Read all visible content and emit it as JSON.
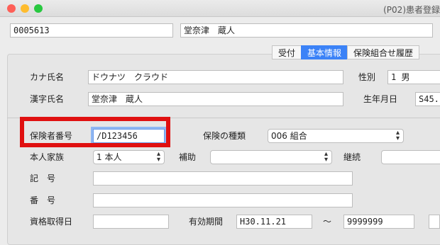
{
  "window": {
    "title": "(P02)患者登録"
  },
  "header": {
    "patient_id": "0005613",
    "patient_name": "堂奈津　蔵人"
  },
  "tabs": [
    {
      "label": "受付",
      "active": false
    },
    {
      "label": "基本情報",
      "active": true
    },
    {
      "label": "保険組合せ履歴",
      "active": false
    }
  ],
  "basic": {
    "kana_label": "カナ氏名",
    "kana_value": "ドウナツ　クラウド",
    "kanji_label": "漢字氏名",
    "kanji_value": "堂奈津　蔵人",
    "sex_label": "性別",
    "sex_value": "1 男",
    "birth_label": "生年月日",
    "birth_value": "S45."
  },
  "insurance": {
    "insurer_label": "保険者番号",
    "insurer_value": "/D123456",
    "type_label": "保険の種類",
    "type_value": "006 組合",
    "family_label": "本人家族",
    "family_value": "1 本人",
    "aux_label": "補助",
    "aux_value": "",
    "cont_label": "継続",
    "cont_value": "",
    "kigo_label": "記　号",
    "kigo_value": "",
    "bango_label": "番　号",
    "bango_value": "",
    "acq_label": "資格取得日",
    "acq_value": "",
    "period_label": "有効期間",
    "period_from": "H30.11.21",
    "tilde": "〜",
    "period_to": "9999999"
  },
  "colors": {
    "highlight": "#e01010",
    "active_tab": "#3b82f7"
  }
}
